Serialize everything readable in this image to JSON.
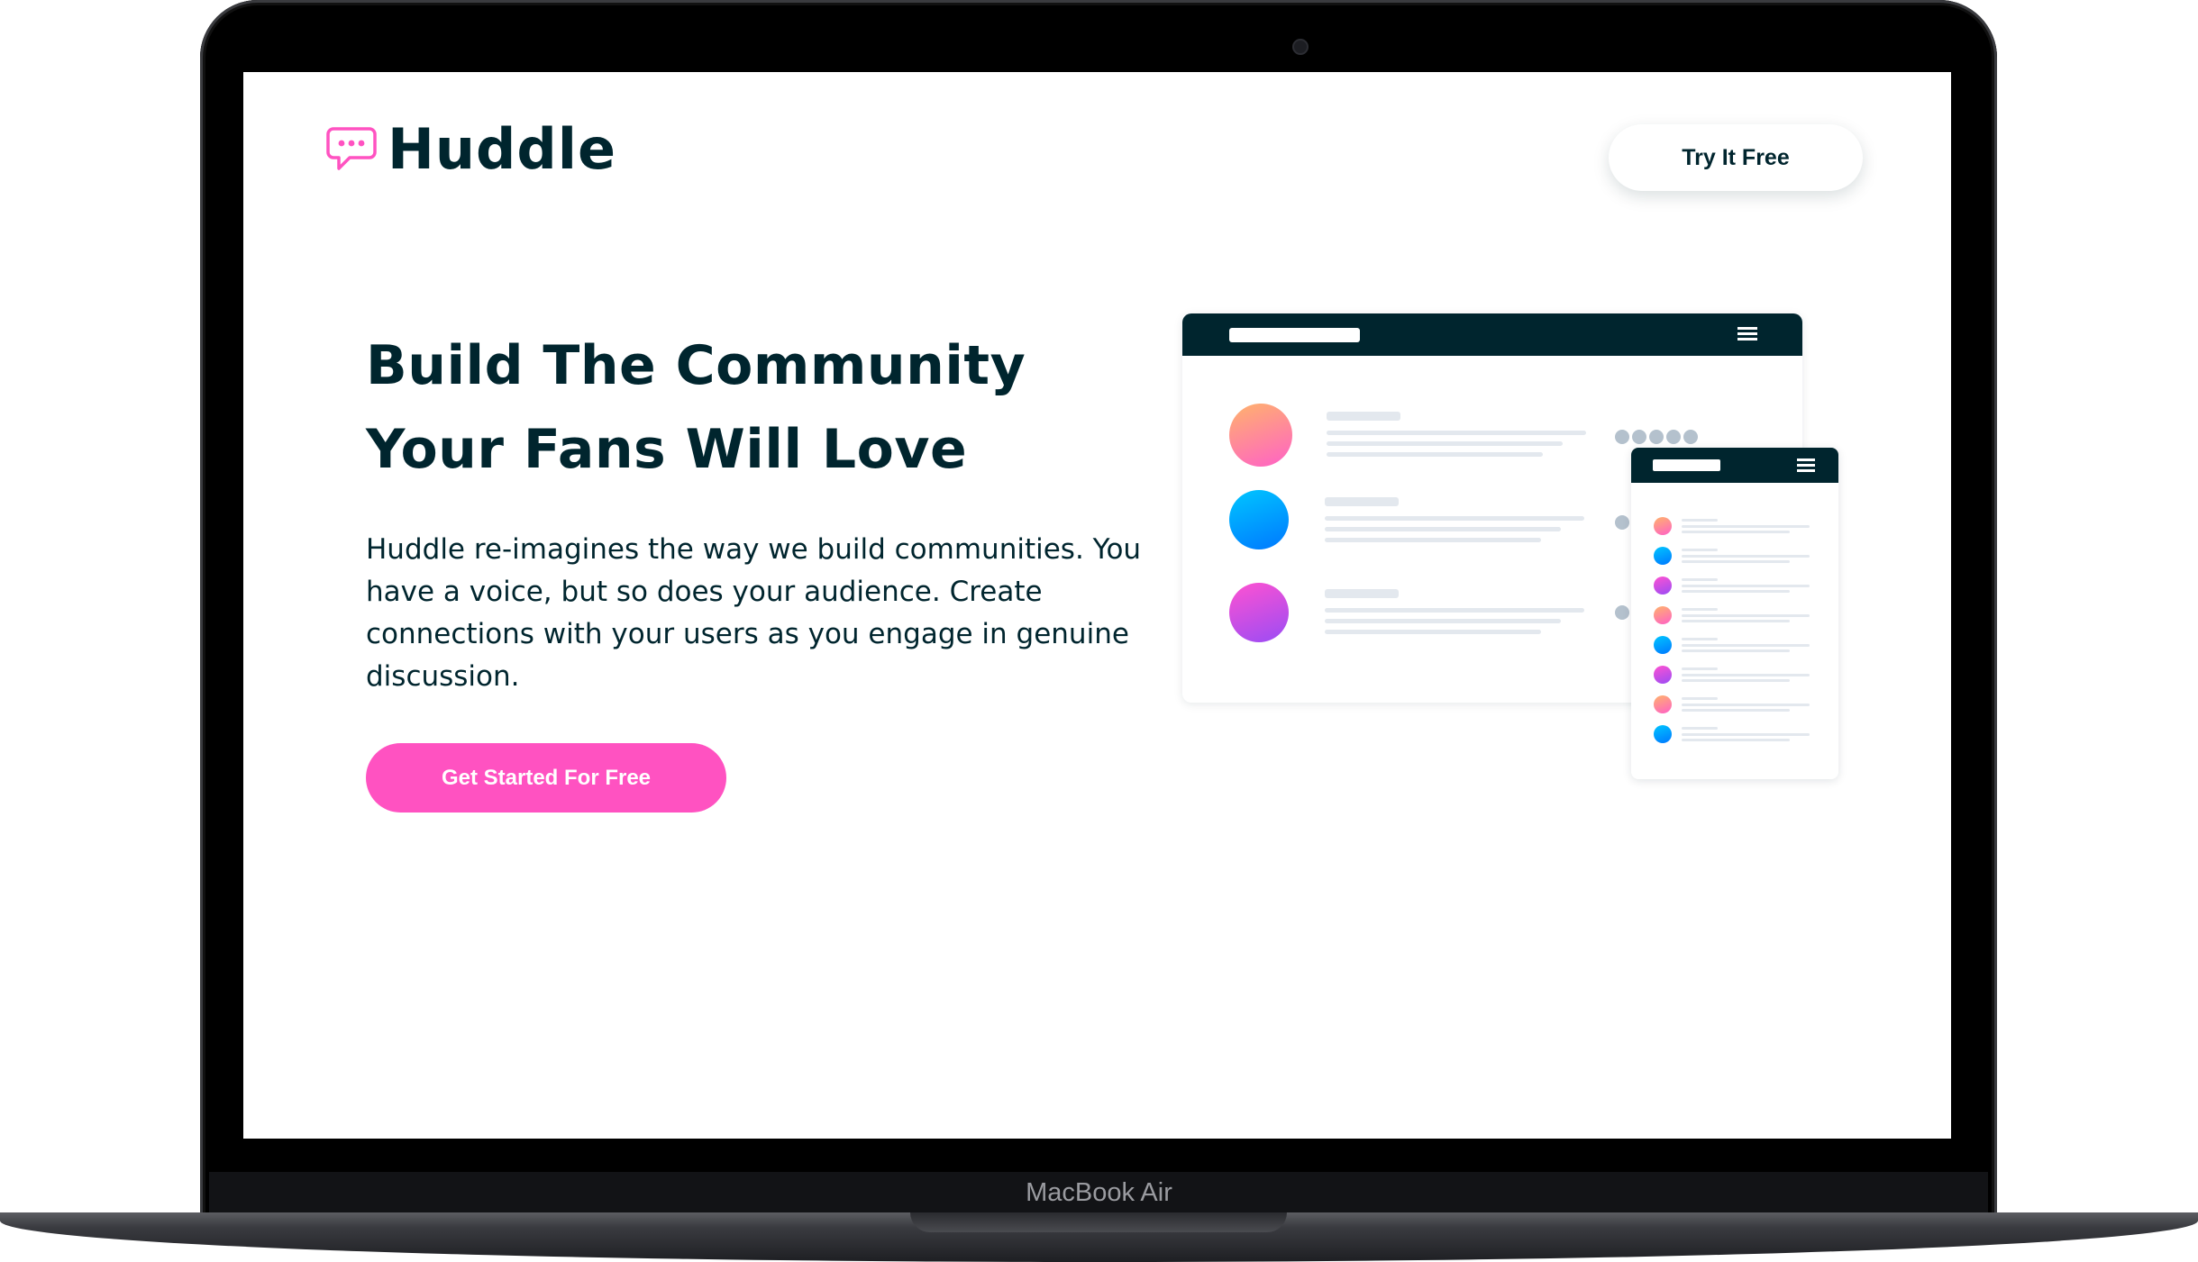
{
  "device": {
    "label": "MacBook Air"
  },
  "header": {
    "brand": "Huddle",
    "brand_color": "#00252e",
    "logo_icon": "chat-bubble-icon",
    "try_button_label": "Try It Free"
  },
  "hero": {
    "headline": "Build The Community Your Fans Will Love",
    "paragraph": "Huddle re-imagines the way we build communities. You have a voice, but so does your audience. Create connections with your users as you engage in genuine discussion.",
    "cta_label": "Get Started For Free",
    "cta_color": "#ff52c1"
  },
  "illustration": {
    "main_window_avatars": [
      "orange-pink",
      "blue",
      "pink-purple"
    ],
    "side_window_avatars": [
      "orange-pink",
      "blue",
      "pink-purple",
      "orange-pink",
      "blue",
      "pink-purple",
      "orange-pink",
      "blue"
    ],
    "bar_color": "#00252e"
  }
}
